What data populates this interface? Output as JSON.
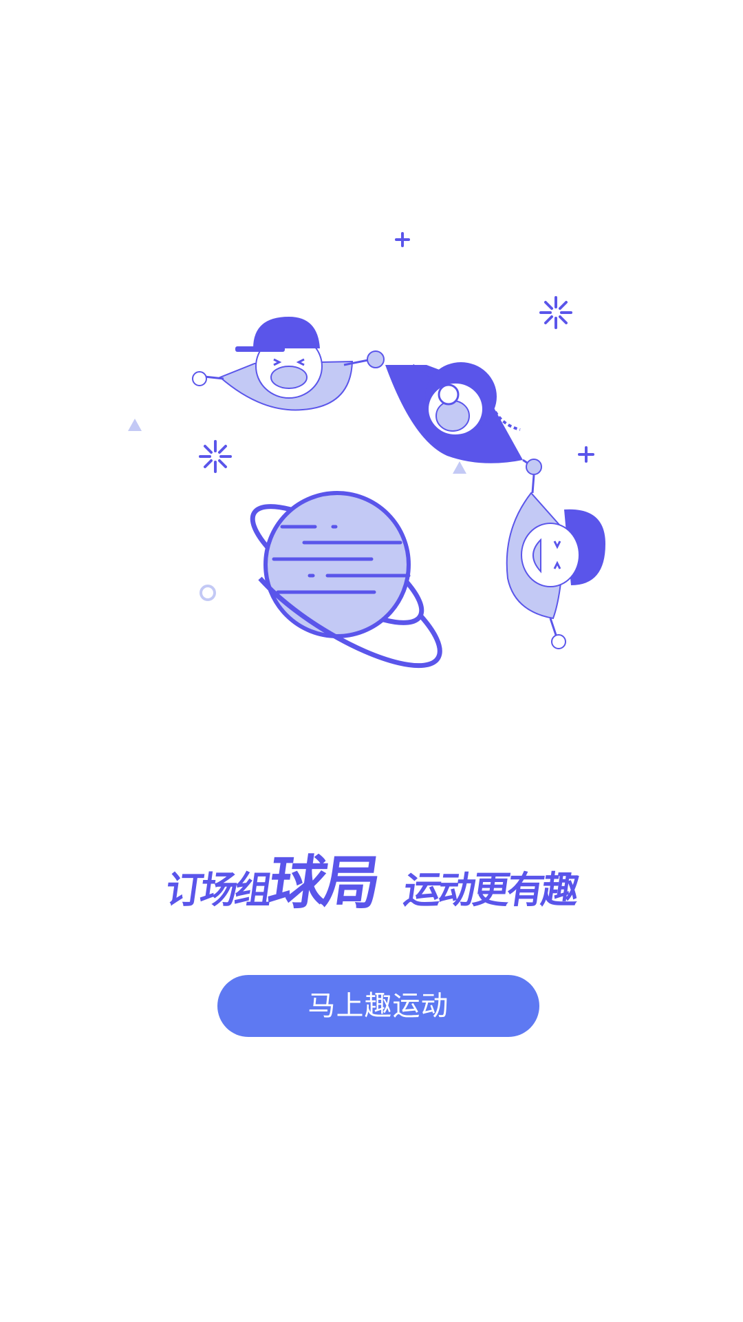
{
  "slogan": {
    "part_a": "订场组",
    "part_b": "球局",
    "part_c": "运动更有趣"
  },
  "cta": {
    "label": "马上趣运动"
  },
  "colors": {
    "primary": "#5a55ea",
    "light_fill": "#c3c9f5",
    "button": "#5e79f2",
    "background": "#ffffff"
  },
  "icons": [
    "sparkle-icon",
    "plus-icon",
    "triangle-icon",
    "ring-icon",
    "planet-icon"
  ]
}
